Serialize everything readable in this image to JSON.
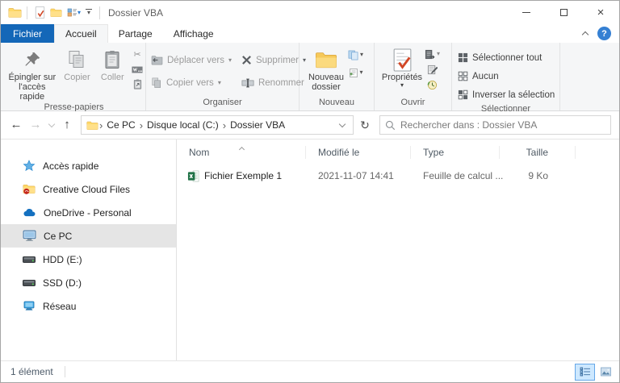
{
  "colors": {
    "accent_blue": "#1467b8",
    "selection_gray": "#e5e5e5",
    "folder_yellow": "#ffd969",
    "excel_green": "#1e7145",
    "help_blue": "#3580d3"
  },
  "titlebar": {
    "title": "Dossier VBA"
  },
  "window_controls": {
    "close": "×"
  },
  "tabs": {
    "file": "Fichier",
    "home": "Accueil",
    "share": "Partage",
    "view": "Affichage",
    "help": "?"
  },
  "ribbon": {
    "pin": "Épingler sur l'accès rapide",
    "copy": "Copier",
    "paste": "Coller",
    "group_clipboard": "Presse-papiers",
    "cut_glyph": "✂",
    "move_to": "Déplacer vers",
    "copy_to": "Copier vers",
    "delete": "Supprimer",
    "rename": "Renommer",
    "group_organize": "Organiser",
    "new_folder_1": "Nouveau",
    "new_folder_2": "dossier",
    "group_new": "Nouveau",
    "properties": "Propriétés",
    "group_open": "Ouvrir",
    "select_all": "Sélectionner tout",
    "select_none": "Aucun",
    "select_invert": "Inverser la sélection",
    "group_select": "Sélectionner",
    "caret": "▾"
  },
  "navbar": {
    "back": "←",
    "forward": "→",
    "up": "↑",
    "refresh": "↻",
    "crumb_sep": "›",
    "crumbs": {
      "root": "Ce PC",
      "drive": "Disque local (C:)",
      "folder": "Dossier VBA"
    },
    "search_placeholder": "Rechercher dans : Dossier VBA"
  },
  "sidebar": {
    "items": [
      {
        "label": "Accès rapide"
      },
      {
        "label": "Creative Cloud Files"
      },
      {
        "label": "OneDrive - Personal"
      },
      {
        "label": "Ce PC"
      },
      {
        "label": "HDD (E:)"
      },
      {
        "label": "SSD (D:)"
      },
      {
        "label": "Réseau"
      }
    ]
  },
  "filelist": {
    "col_name": "Nom",
    "col_modified": "Modifié le",
    "col_type": "Type",
    "col_size": "Taille",
    "row": {
      "name": "Fichier Exemple 1",
      "modified": "2021-11-07 14:41",
      "type": "Feuille de calcul ...",
      "size": "9 Ko"
    }
  },
  "statusbar": {
    "count": "1 élément"
  }
}
